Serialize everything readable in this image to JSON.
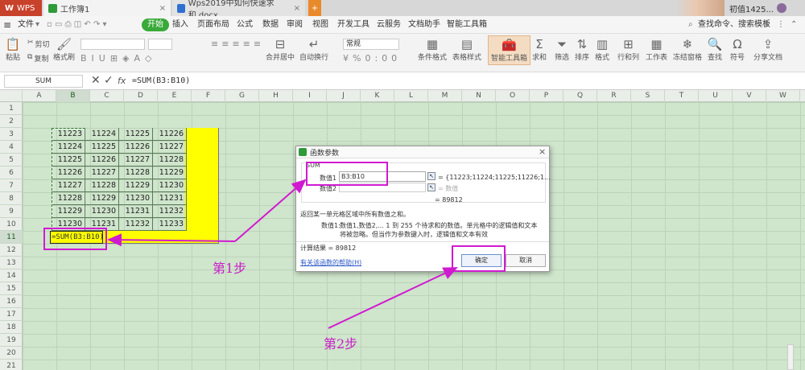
{
  "tabs": {
    "app": "WPS",
    "workbook": "工作簿1",
    "doc": "Wps2019中如何快速求和.docx",
    "user": "初值1425..."
  },
  "menu": {
    "file": "文件",
    "items": [
      "开始",
      "插入",
      "页面布局",
      "公式",
      "数据",
      "审阅",
      "视图",
      "开发工具",
      "云服务",
      "文档助手",
      "智能工具箱"
    ],
    "search": "查找命令、搜索模板"
  },
  "ribbon": {
    "paste": "粘贴",
    "cut": "剪切",
    "copy": "复制",
    "format_painter": "格式刷",
    "merge": "合并居中",
    "wrap": "自动换行",
    "number_format": "常规",
    "cond_format": "条件格式",
    "table_style": "表格样式",
    "smart_toolbox": "智能工具箱",
    "sum": "求和",
    "filter": "筛选",
    "sort": "排序",
    "format": "格式",
    "rowcol": "行和列",
    "sheet": "工作表",
    "freeze": "冻结窗格",
    "find": "查找",
    "symbol": "符号",
    "share": "分享文档"
  },
  "formula_bar": {
    "name_box": "SUM",
    "fx": "fx",
    "formula": "=SUM(B3:B10)"
  },
  "columns": [
    "A",
    "B",
    "C",
    "D",
    "E",
    "F",
    "G",
    "H",
    "I",
    "J",
    "K",
    "L",
    "M",
    "N",
    "O",
    "P",
    "Q",
    "R",
    "S",
    "T",
    "U",
    "V",
    "W"
  ],
  "rows": [
    "1",
    "2",
    "3",
    "4",
    "5",
    "6",
    "7",
    "8",
    "9",
    "10",
    "11",
    "12",
    "13",
    "14",
    "15",
    "16",
    "17",
    "18",
    "19",
    "20",
    "21"
  ],
  "table": [
    [
      "11223",
      "11224",
      "11225",
      "11226"
    ],
    [
      "11224",
      "11225",
      "11226",
      "11227"
    ],
    [
      "11225",
      "11226",
      "11227",
      "11228"
    ],
    [
      "11226",
      "11227",
      "11228",
      "11229"
    ],
    [
      "11227",
      "11228",
      "11229",
      "11230"
    ],
    [
      "11228",
      "11229",
      "11230",
      "11231"
    ],
    [
      "11229",
      "11230",
      "11231",
      "11232"
    ],
    [
      "11230",
      "11231",
      "11232",
      "11233"
    ]
  ],
  "active_cell": "=SUM(B3:B10)",
  "dialog": {
    "title": "函数参数",
    "func": "SUM",
    "arg1_label": "数值1",
    "arg1_value": "B3:B10",
    "arg1_result": "= {11223;11224;11225;11226;1...",
    "arg2_label": "数值2",
    "arg2_placeholder": "= 数值",
    "total": "= 89812",
    "desc": "返回某一单元格区域中所有数值之和。",
    "arg_desc_label": "数值1:",
    "arg_desc": "数值1,数值2,... 1 到 255 个待求和的数值。单元格中的逻辑值和文本将被忽略。但当作为参数键入时，逻辑值和文本有效",
    "result": "计算结果 = 89812",
    "help": "有关该函数的帮助(H)",
    "ok": "确定",
    "cancel": "取消"
  },
  "annotations": {
    "step1": "第1步",
    "step2": "第2步"
  },
  "colors": {
    "highlight": "#d01ad0",
    "yellow": "#ffff00",
    "sheet": "#cfe5cc",
    "start_tab": "#39a939"
  }
}
